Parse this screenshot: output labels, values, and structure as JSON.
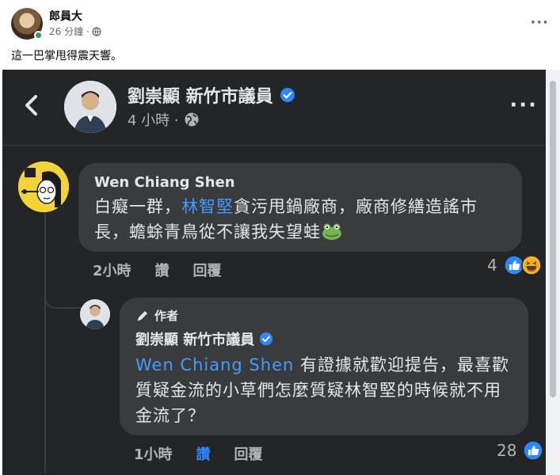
{
  "post": {
    "author": "郎員大",
    "time": "26 分鐘 ·",
    "text": "這一巴掌甩得震天響。",
    "more_label": "···"
  },
  "screenshot": {
    "back_label": "<",
    "page_name": "劉崇顯 新竹市議員",
    "page_time": "4 小時 ·",
    "more_label": "···",
    "comment": {
      "author": "Wen Chiang Shen",
      "text_before": "白癡一群，",
      "mention": "林智堅",
      "text_after": "貪污甩鍋廠商，廠商修繕造謠市長，蟾蜍青鳥從不讓我失望蛙",
      "time": "2小時",
      "like_label": "讚",
      "reply_label": "回覆",
      "reaction_count": "4"
    },
    "reply": {
      "author_tag": "作者",
      "author": "劉崇顯 新竹市議員",
      "mention": "Wen Chiang Shen",
      "text": "有證據就歡迎提告，最喜歡質疑金流的小草們怎麼質疑林智堅的時候就不用金流了？",
      "time": "1小時",
      "like_label": "讚",
      "reply_label": "回覆",
      "reaction_count": "28"
    }
  },
  "colors": {
    "dark_bg": "#242526",
    "bubble_bg": "#3a3b3c",
    "mention_blue": "#4599ff",
    "like_blue": "#2d88ff",
    "verified_blue": "#2d88ff",
    "online_green": "#31a24c"
  },
  "icons": [
    "globe-icon",
    "verified-badge-icon",
    "back-arrow-icon",
    "more-icon",
    "frog-emoji-icon",
    "like-icon",
    "haha-icon",
    "pencil-icon"
  ]
}
